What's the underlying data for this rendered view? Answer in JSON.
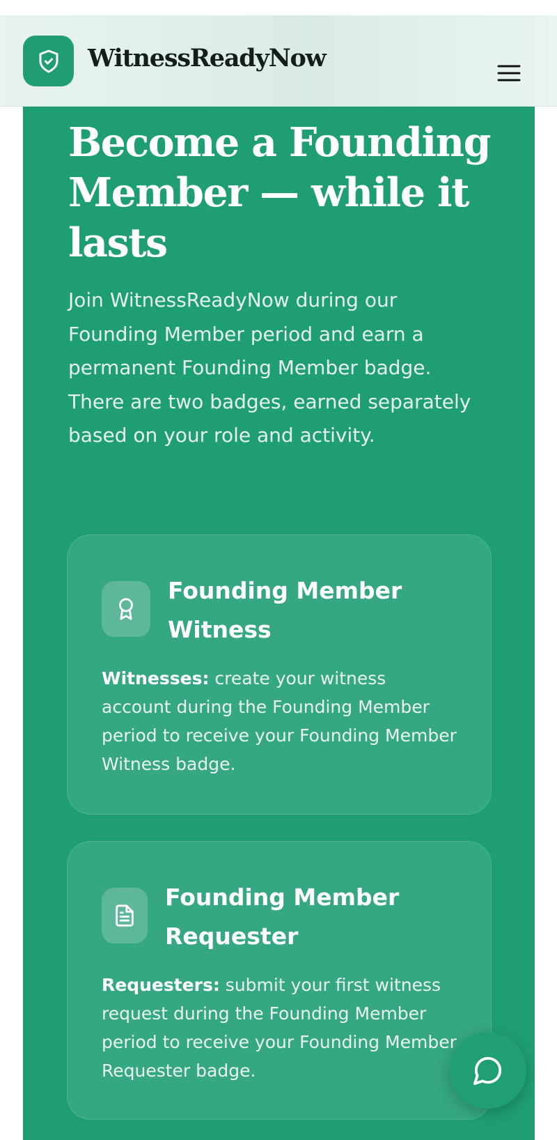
{
  "header": {
    "brand_name": "WitnessReadyNow",
    "logo_icon": "shield-check-icon",
    "menu_icon": "hamburger-menu-icon"
  },
  "hero": {
    "title": "Become a Founding Member — while it lasts",
    "description": "Join WitnessReadyNow during our Founding Member period and earn a permanent Founding Member badge. There are two badges, earned separately based on your role and activity."
  },
  "badges": [
    {
      "icon": "award-ribbon-icon",
      "title": "Founding Member Witness",
      "lead": "Witnesses:",
      "text": " create your witness account during the Founding Member period to receive your Founding Member Witness badge."
    },
    {
      "icon": "document-icon",
      "title": "Founding Member Requester",
      "lead": "Requesters:",
      "text": " submit your first witness request during the Founding Member period to receive your Founding Member Requester badge."
    }
  ],
  "chat": {
    "icon": "chat-bubble-icon"
  },
  "colors": {
    "accent": "#1f9e74",
    "header_bg": "#dcede6",
    "text_dark": "#141d1a"
  }
}
